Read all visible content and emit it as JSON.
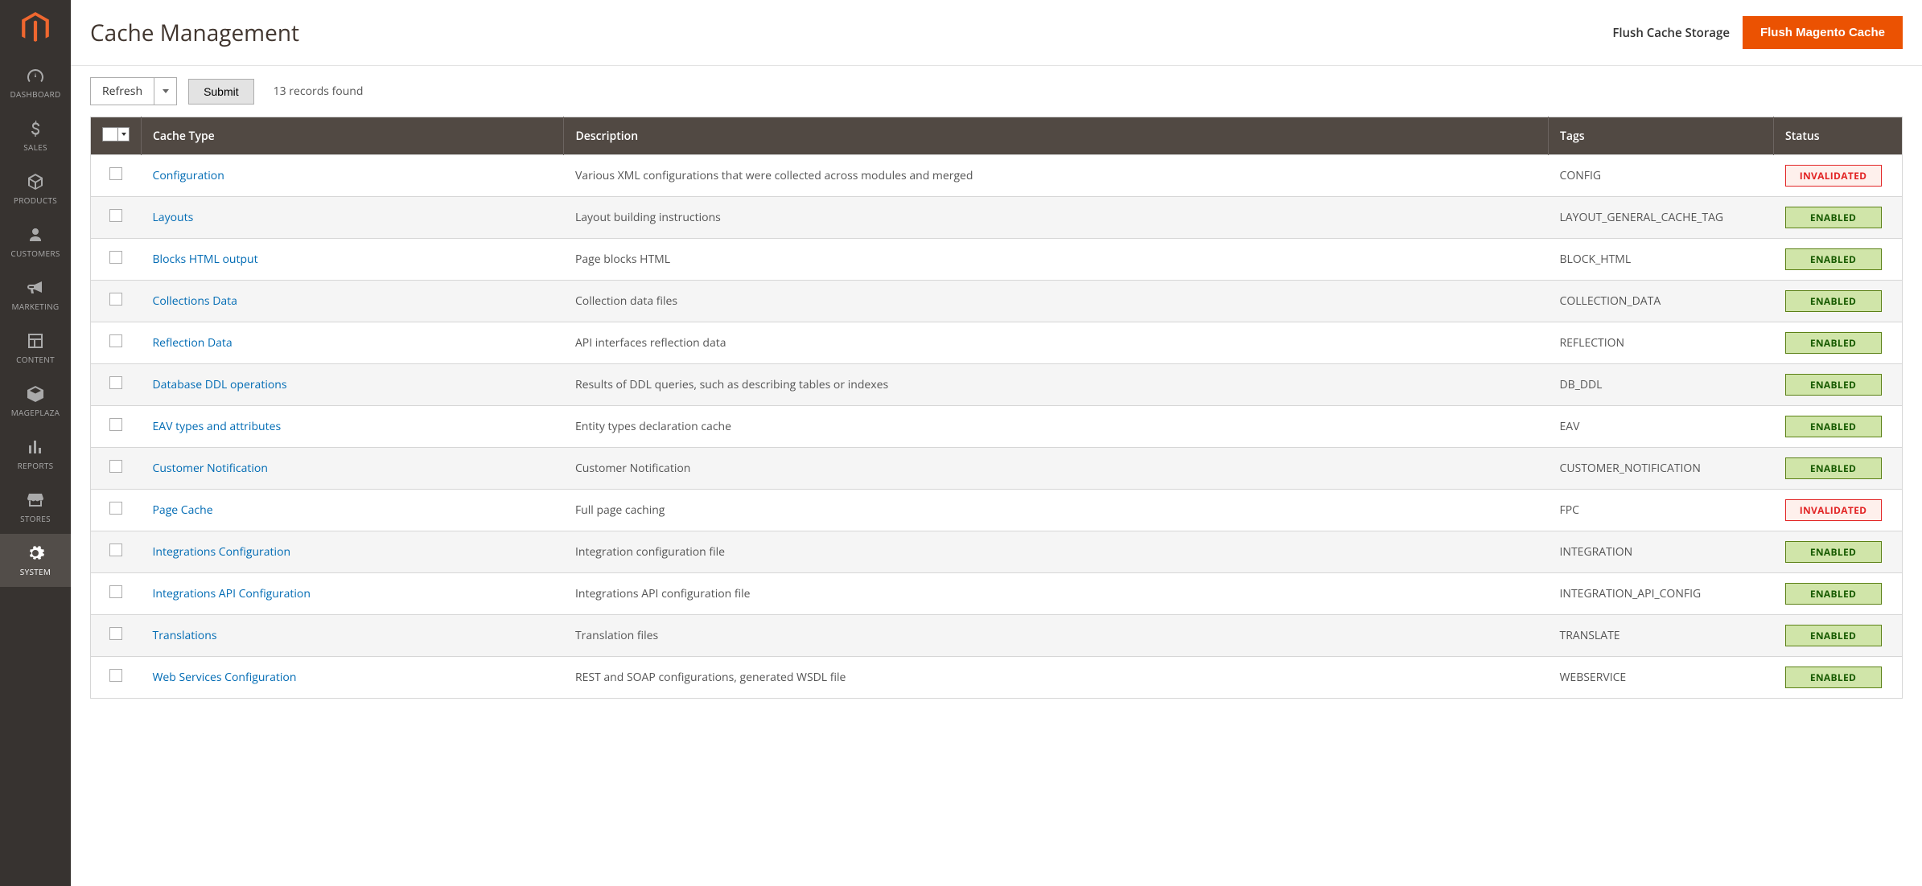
{
  "sidebar": {
    "items": [
      {
        "label": "DASHBOARD",
        "name": "sidebar-item-dashboard"
      },
      {
        "label": "SALES",
        "name": "sidebar-item-sales"
      },
      {
        "label": "PRODUCTS",
        "name": "sidebar-item-products"
      },
      {
        "label": "CUSTOMERS",
        "name": "sidebar-item-customers"
      },
      {
        "label": "MARKETING",
        "name": "sidebar-item-marketing"
      },
      {
        "label": "CONTENT",
        "name": "sidebar-item-content"
      },
      {
        "label": "MAGEPLAZA",
        "name": "sidebar-item-mageplaza"
      },
      {
        "label": "REPORTS",
        "name": "sidebar-item-reports"
      },
      {
        "label": "STORES",
        "name": "sidebar-item-stores"
      },
      {
        "label": "SYSTEM",
        "name": "sidebar-item-system"
      }
    ]
  },
  "header": {
    "title": "Cache Management",
    "flush_storage": "Flush Cache Storage",
    "flush_magento": "Flush Magento Cache"
  },
  "controls": {
    "action_label": "Refresh",
    "submit_label": "Submit",
    "records_found": "13 records found"
  },
  "table": {
    "headers": {
      "cache_type": "Cache Type",
      "description": "Description",
      "tags": "Tags",
      "status": "Status"
    },
    "rows": [
      {
        "type": "Configuration",
        "description": "Various XML configurations that were collected across modules and merged",
        "tags": "CONFIG",
        "status": "INVALIDATED",
        "status_kind": "invalidated"
      },
      {
        "type": "Layouts",
        "description": "Layout building instructions",
        "tags": "LAYOUT_GENERAL_CACHE_TAG",
        "status": "ENABLED",
        "status_kind": "enabled"
      },
      {
        "type": "Blocks HTML output",
        "description": "Page blocks HTML",
        "tags": "BLOCK_HTML",
        "status": "ENABLED",
        "status_kind": "enabled"
      },
      {
        "type": "Collections Data",
        "description": "Collection data files",
        "tags": "COLLECTION_DATA",
        "status": "ENABLED",
        "status_kind": "enabled"
      },
      {
        "type": "Reflection Data",
        "description": "API interfaces reflection data",
        "tags": "REFLECTION",
        "status": "ENABLED",
        "status_kind": "enabled"
      },
      {
        "type": "Database DDL operations",
        "description": "Results of DDL queries, such as describing tables or indexes",
        "tags": "DB_DDL",
        "status": "ENABLED",
        "status_kind": "enabled"
      },
      {
        "type": "EAV types and attributes",
        "description": "Entity types declaration cache",
        "tags": "EAV",
        "status": "ENABLED",
        "status_kind": "enabled"
      },
      {
        "type": "Customer Notification",
        "description": "Customer Notification",
        "tags": "CUSTOMER_NOTIFICATION",
        "status": "ENABLED",
        "status_kind": "enabled"
      },
      {
        "type": "Page Cache",
        "description": "Full page caching",
        "tags": "FPC",
        "status": "INVALIDATED",
        "status_kind": "invalidated"
      },
      {
        "type": "Integrations Configuration",
        "description": "Integration configuration file",
        "tags": "INTEGRATION",
        "status": "ENABLED",
        "status_kind": "enabled"
      },
      {
        "type": "Integrations API Configuration",
        "description": "Integrations API configuration file",
        "tags": "INTEGRATION_API_CONFIG",
        "status": "ENABLED",
        "status_kind": "enabled"
      },
      {
        "type": "Translations",
        "description": "Translation files",
        "tags": "TRANSLATE",
        "status": "ENABLED",
        "status_kind": "enabled"
      },
      {
        "type": "Web Services Configuration",
        "description": "REST and SOAP configurations, generated WSDL file",
        "tags": "WEBSERVICE",
        "status": "ENABLED",
        "status_kind": "enabled"
      }
    ]
  }
}
